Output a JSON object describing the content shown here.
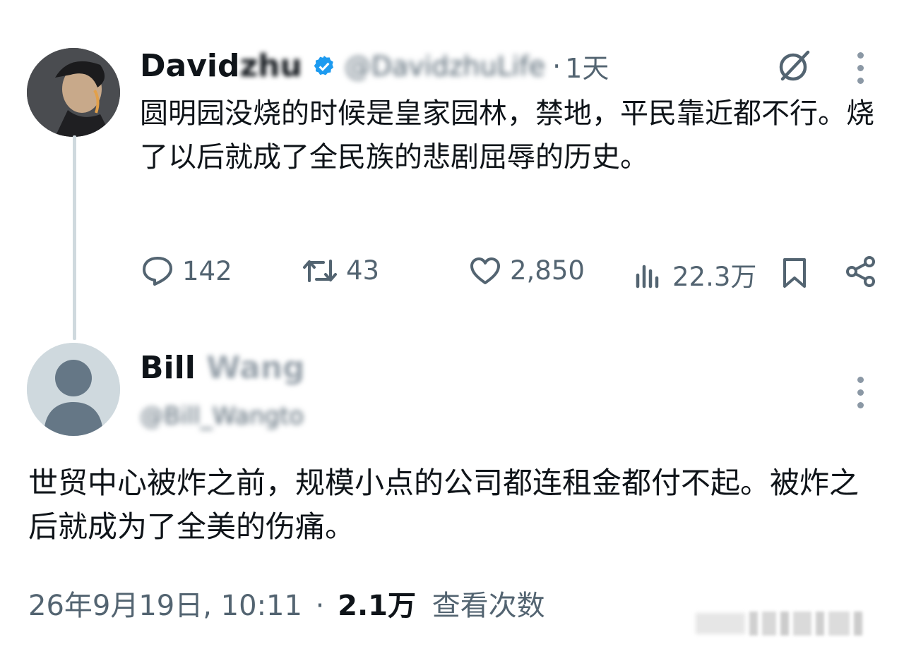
{
  "tweet": {
    "author_name_visible": "David",
    "author_name_blurred": "zhu",
    "handle_blurred": "@DavidzhuLife",
    "time_sep": "·",
    "time": "1天",
    "text": "圆明园没烧的时候是皇家园林，禁地，平民靠近都不行。烧了以后就成了全民族的悲剧屈辱的历史。",
    "replies": "142",
    "reposts": "43",
    "likes": "2,850",
    "views": "22.3万",
    "verified_color": "#1d9bf0"
  },
  "reply": {
    "author_name_visible": "Bill",
    "author_name_blurred": "Wang",
    "handle_blurred": "@Bill_Wangto",
    "text": "世贸中心被炸之前，规模小点的公司都连租金都付不起。被炸之后就成为了全美的伤痛。",
    "date": "26年9月19日, 10:11",
    "dot": "·",
    "views_count": "2.1万",
    "views_label": "查看次数"
  },
  "icons": [
    "grok-icon",
    "more-icon",
    "reply-icon",
    "repost-icon",
    "like-icon",
    "views-icon",
    "bookmark-icon",
    "share-icon",
    "verified-badge-icon"
  ],
  "colors": {
    "text": "#0f1419",
    "muted": "#536471",
    "thread_line": "#cfd9de"
  }
}
